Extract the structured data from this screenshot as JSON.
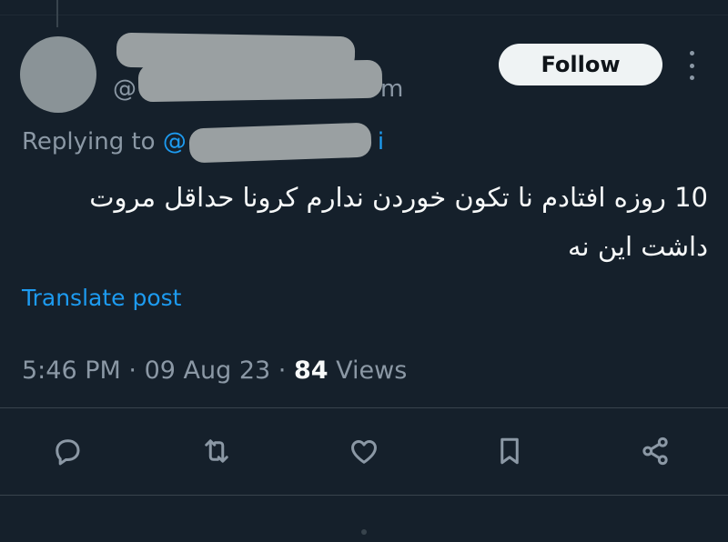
{
  "author": {
    "handle_prefix": "@",
    "handle_suffix": "m"
  },
  "follow_button": {
    "label": "Follow"
  },
  "reply": {
    "prefix": "Replying to ",
    "mention_prefix": "@",
    "mention_suffix": "i"
  },
  "tweet": {
    "text": "10 روزه افتادم نا تکون خوردن ندارم کرونا حداقل مروت داشت این نه"
  },
  "translate": {
    "label": "Translate post"
  },
  "meta": {
    "time": "5:46 PM",
    "separator": "·",
    "date": "09 Aug 23",
    "views_count": "84",
    "views_label": "Views"
  },
  "actions": [
    {
      "icon": "reply-icon"
    },
    {
      "icon": "retweet-icon"
    },
    {
      "icon": "like-icon"
    },
    {
      "icon": "bookmark-icon"
    },
    {
      "icon": "share-icon"
    }
  ],
  "colors": {
    "background": "#15202b",
    "accent": "#1d9bf0",
    "muted": "#8b98a5",
    "text": "#f7f9f9"
  }
}
